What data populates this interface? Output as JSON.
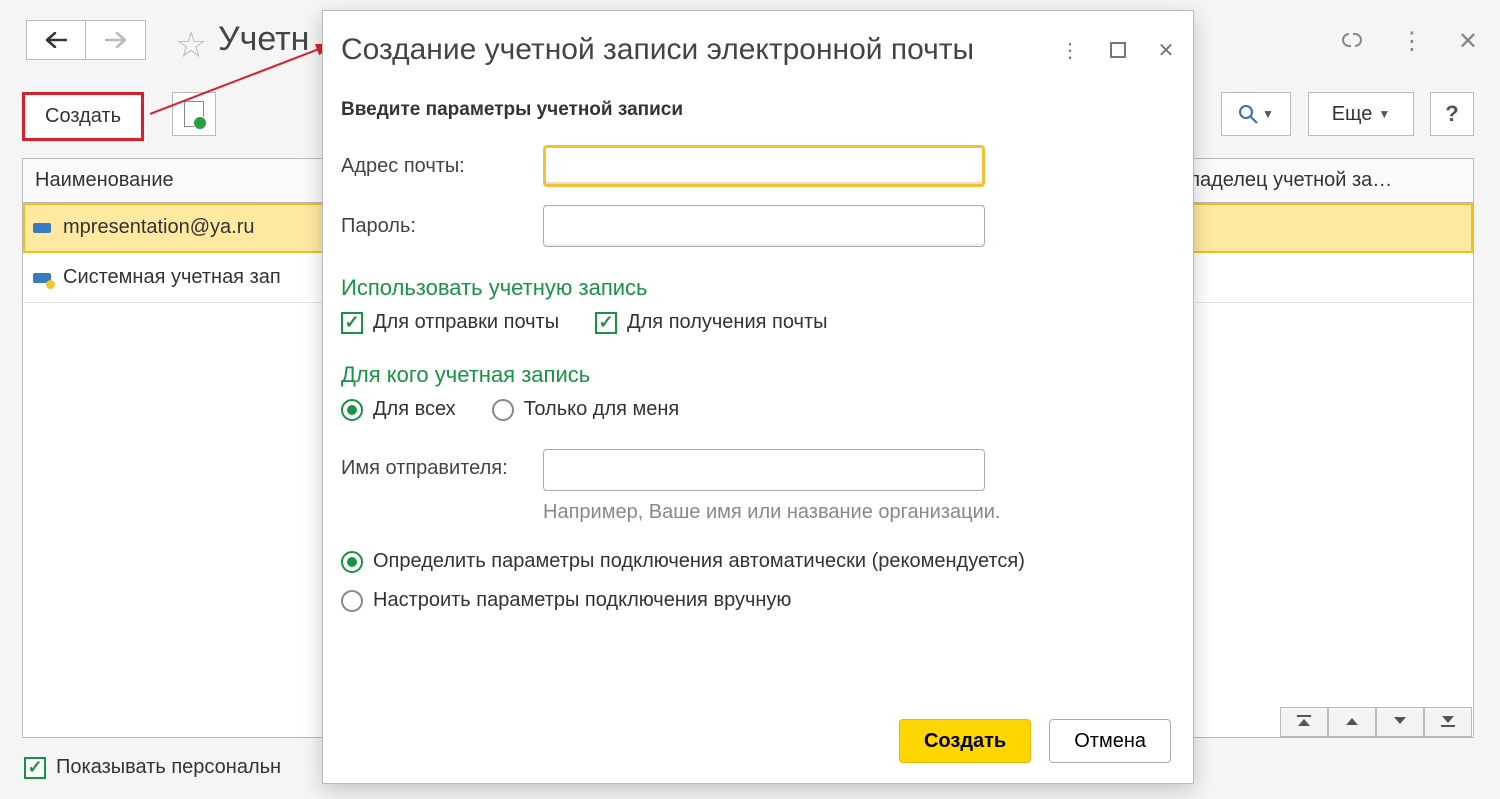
{
  "page": {
    "title": "Учетн",
    "create_button": "Создать",
    "more_button": "Еще",
    "help_button": "?",
    "show_personal": "Показывать персональн"
  },
  "table": {
    "columns": {
      "name": "Наименование",
      "owner": "Владелец учетной за…"
    },
    "rows": [
      {
        "label": "mpresentation@ya.ru",
        "selected": true,
        "system": false
      },
      {
        "label": "Системная учетная зап",
        "selected": false,
        "system": true
      }
    ]
  },
  "dialog": {
    "title": "Создание учетной записи электронной почты",
    "subtitle": "Введите параметры учетной записи",
    "email_label": "Адрес почты:",
    "email_value": "",
    "password_label": "Пароль:",
    "password_value": "",
    "use_account_header": "Использовать учетную запись",
    "chk_send": "Для отправки почты",
    "chk_recv": "Для получения почты",
    "for_whom_header": "Для кого учетная запись",
    "radio_all": "Для всех",
    "radio_me": "Только для меня",
    "sender_label": "Имя отправителя:",
    "sender_value": "",
    "sender_hint": "Например, Ваше имя или название организации.",
    "conn_auto": "Определить параметры подключения автоматически (рекомендуется)",
    "conn_manual": "Настроить параметры подключения вручную",
    "btn_create": "Создать",
    "btn_cancel": "Отмена"
  }
}
